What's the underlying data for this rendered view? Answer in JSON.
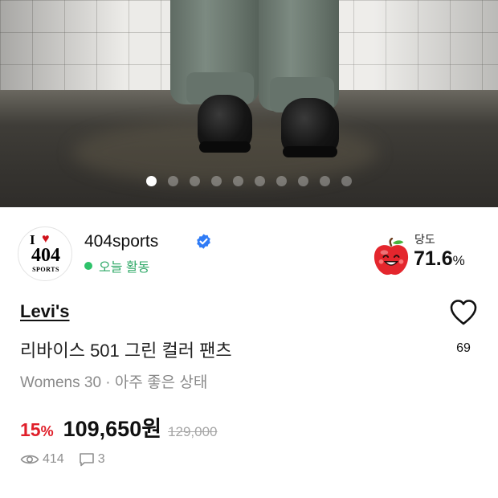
{
  "carousel": {
    "total_images": 10,
    "active_index": 0
  },
  "seller": {
    "avatar_text_top": "I",
    "avatar_text_num": "404",
    "avatar_text_word": "SPORTS",
    "name": "404sports",
    "verified_icon": "verified-check-icon",
    "activity_status": "오늘 활동",
    "activity_color": "#2ec26a"
  },
  "sweetness": {
    "label": "당도",
    "value": "71.6",
    "unit": "%",
    "icon": "apple-face-icon"
  },
  "product": {
    "brand": "Levi's",
    "title": "리바이스 501 그린 컬러 팬츠",
    "meta": "Womens 30 · 아주 좋은 상태",
    "discount_value": "15",
    "discount_unit": "%",
    "price": "109,650원",
    "original_price": "129,000",
    "discount_color": "#e01f2a"
  },
  "like": {
    "icon": "heart-icon",
    "count": "69"
  },
  "stats": {
    "views_icon": "eye-icon",
    "views": "414",
    "comments_icon": "comment-icon",
    "comments": "3"
  }
}
